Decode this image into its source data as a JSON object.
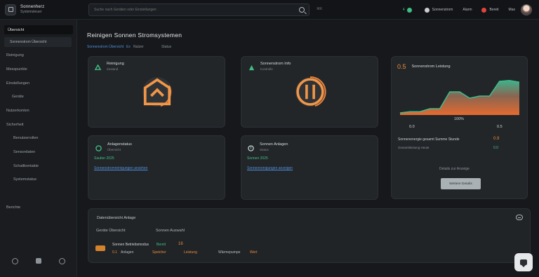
{
  "topbar": {
    "brand_name": "Sonnenherz",
    "brand_sub": "Systemsteuer",
    "search_placeholder": "Suche nach Geräten oder Einstellungen",
    "search_shortcut": "⌘K",
    "status": [
      {
        "level": "4",
        "label": "S",
        "color": "#3fbf86"
      },
      {
        "label": "Sonnenstrom",
        "color": "#c9ccd0"
      },
      {
        "label": "Alarm",
        "color": "#c9ccd0"
      },
      {
        "label": "Bereit",
        "color": "#e0443a"
      },
      {
        "label": "Max"
      }
    ]
  },
  "sidebar": {
    "primary": "Übersicht",
    "secondary": "Sonnenstrom Übersicht",
    "items": [
      "Reinigung",
      "Messpunkte",
      "Einstellungen",
      "Geräte",
      "Nutzerkonten",
      "Sicherheit",
      "Benutzerrollen",
      "Sensordaten",
      "Schaltkontakte",
      "Systemstatus",
      "Berichte"
    ]
  },
  "main": {
    "title": "Reinigen Sonnen Stromsystemen",
    "breadcrumb": [
      "Sonnenstrom Übersicht",
      "Ex",
      "Nutzer",
      "Status"
    ]
  },
  "cards": {
    "c1": {
      "title": "Reinigung",
      "sub": "Zustand"
    },
    "c2": {
      "title": "Sonnenstrom Info",
      "sub": "Kontrolle"
    },
    "c3": {
      "title": "Anlagenstatus",
      "sub": "Übersicht",
      "line1": "Sauber 2025",
      "link": "Sonnenstromreinigungen ansehen"
    },
    "c4": {
      "title": "Sonnen Anlagen",
      "sub": "Status",
      "line1": "Sonnen 2025",
      "link": "Sonnenreinigungen anzeigen"
    },
    "chart": {
      "big": "0.5",
      "label": "Sonnenstrom Leistung",
      "ticks": [
        "0.0",
        "100%",
        "0.5"
      ],
      "stat_label": "Sonnenenergie gesamt Summe Stunde",
      "stat_val": "0.9",
      "stat_sub": "Gesamtleistung Heute",
      "stat_val2": "0.0",
      "more": "Details zur Anzeige",
      "button": "Weitere Details"
    }
  },
  "chart_data": {
    "type": "area",
    "x": [
      0,
      1,
      2,
      3,
      4,
      5,
      6,
      7,
      8,
      9,
      10,
      11,
      12
    ],
    "series": [
      {
        "values": [
          0.05,
          0.08,
          0.08,
          0.15,
          0.15,
          0.55,
          0.55,
          0.4,
          0.45,
          0.45,
          0.8,
          0.82,
          0.78
        ]
      }
    ]
  },
  "panel": {
    "title": "Datenübersicht Anlage",
    "row": [
      "Geräte Übersicht",
      "Sonnen Auswahl"
    ],
    "legend_main": "Sonnen Betriebsmodus",
    "legend_green": "Bereit",
    "legend_num": "16",
    "legend_items": [
      "Anlagen",
      "Speicher",
      "Leistung",
      "Wärmepumpe",
      "Wert"
    ],
    "legend_prefix": "0.1"
  }
}
